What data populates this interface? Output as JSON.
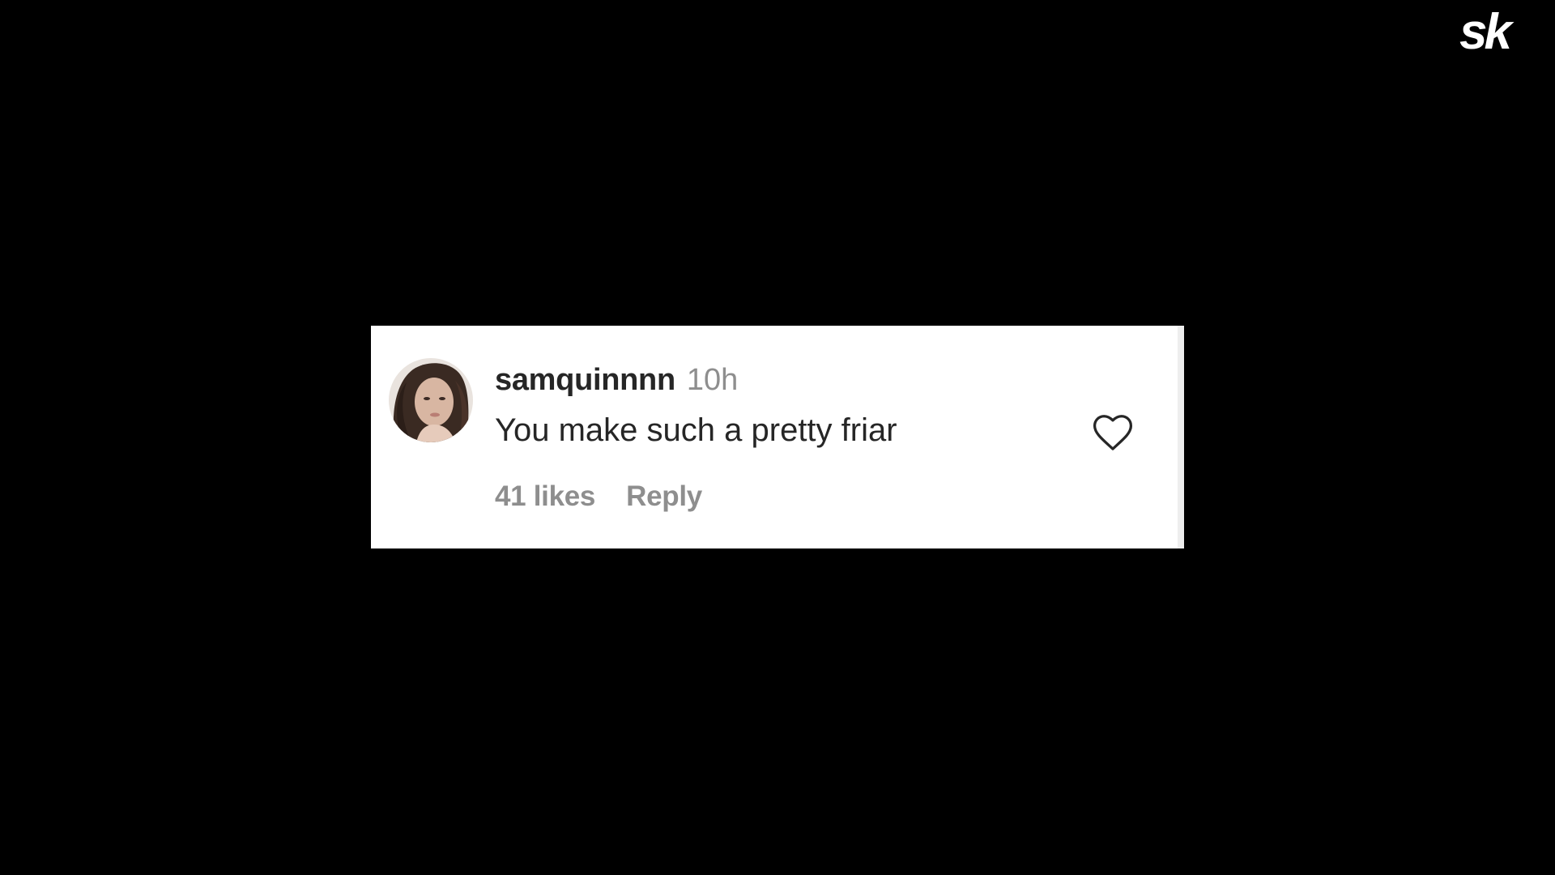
{
  "brand": {
    "logo_text": "sk",
    "color": "#ffffff"
  },
  "comment": {
    "username": "samquinnnn",
    "timestamp": "10h",
    "text": "You make such a pretty friar",
    "likes": "41 likes",
    "reply_label": "Reply",
    "like_icon": "heart-outline-icon"
  },
  "colors": {
    "background": "#000000",
    "card": "#ffffff",
    "primary_text": "#262626",
    "secondary_text": "#8e8e8e"
  }
}
